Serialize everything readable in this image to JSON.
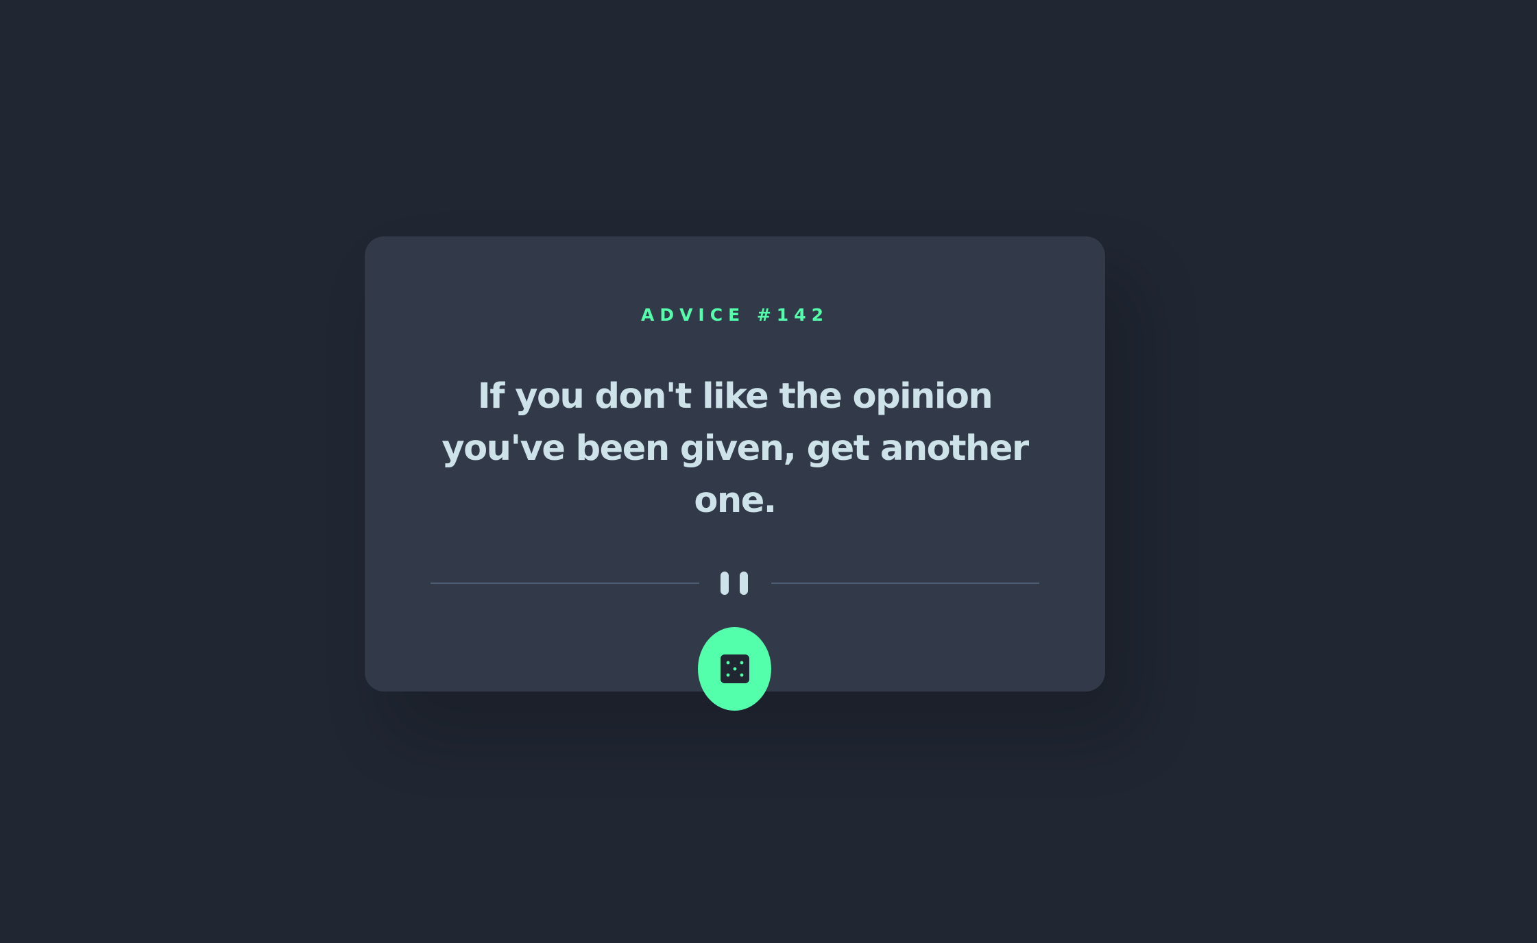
{
  "advice": {
    "label": "ADVICE #142",
    "quote": "If you don't like the opinion you've been given, get another one."
  },
  "colors": {
    "background": "#202632",
    "card": "#323a49",
    "accent": "#53ffaa",
    "text": "#cee3e9",
    "divider": "#4f5d74"
  },
  "icons": {
    "divider": "pause-icon",
    "button": "dice-icon"
  }
}
